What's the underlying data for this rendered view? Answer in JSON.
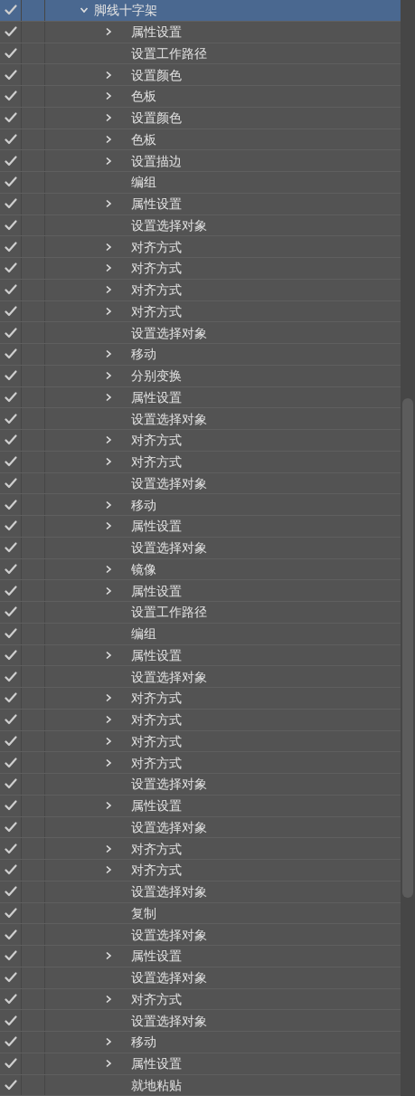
{
  "actions": [
    {
      "name": "脚线十字架",
      "checked": true,
      "selected": true,
      "expanded": true,
      "children": [
        {
          "name": "属性设置",
          "checked": true,
          "expandable": true
        },
        {
          "name": "设置工作路径",
          "checked": true,
          "expandable": false
        },
        {
          "name": "设置颜色",
          "checked": true,
          "expandable": true
        },
        {
          "name": "色板",
          "checked": true,
          "expandable": true
        },
        {
          "name": "设置颜色",
          "checked": true,
          "expandable": true
        },
        {
          "name": "色板",
          "checked": true,
          "expandable": true
        },
        {
          "name": "设置描边",
          "checked": true,
          "expandable": true
        },
        {
          "name": "编组",
          "checked": true,
          "expandable": false
        },
        {
          "name": "属性设置",
          "checked": true,
          "expandable": true
        },
        {
          "name": "设置选择对象",
          "checked": true,
          "expandable": false
        },
        {
          "name": "对齐方式",
          "checked": true,
          "expandable": true
        },
        {
          "name": "对齐方式",
          "checked": true,
          "expandable": true
        },
        {
          "name": "对齐方式",
          "checked": true,
          "expandable": true
        },
        {
          "name": "对齐方式",
          "checked": true,
          "expandable": true
        },
        {
          "name": "设置选择对象",
          "checked": true,
          "expandable": false
        },
        {
          "name": "移动",
          "checked": true,
          "expandable": true
        },
        {
          "name": "分别变换",
          "checked": true,
          "expandable": true
        },
        {
          "name": "属性设置",
          "checked": true,
          "expandable": true
        },
        {
          "name": "设置选择对象",
          "checked": true,
          "expandable": false
        },
        {
          "name": "对齐方式",
          "checked": true,
          "expandable": true
        },
        {
          "name": "对齐方式",
          "checked": true,
          "expandable": true
        },
        {
          "name": "设置选择对象",
          "checked": true,
          "expandable": false
        },
        {
          "name": "移动",
          "checked": true,
          "expandable": true
        },
        {
          "name": "属性设置",
          "checked": true,
          "expandable": true
        },
        {
          "name": "设置选择对象",
          "checked": true,
          "expandable": false
        },
        {
          "name": "镜像",
          "checked": true,
          "expandable": true
        },
        {
          "name": "属性设置",
          "checked": true,
          "expandable": true
        },
        {
          "name": "设置工作路径",
          "checked": true,
          "expandable": false
        },
        {
          "name": "编组",
          "checked": true,
          "expandable": false
        },
        {
          "name": "属性设置",
          "checked": true,
          "expandable": true
        },
        {
          "name": "设置选择对象",
          "checked": true,
          "expandable": false
        },
        {
          "name": "对齐方式",
          "checked": true,
          "expandable": true
        },
        {
          "name": "对齐方式",
          "checked": true,
          "expandable": true
        },
        {
          "name": "对齐方式",
          "checked": true,
          "expandable": true
        },
        {
          "name": "对齐方式",
          "checked": true,
          "expandable": true
        },
        {
          "name": "设置选择对象",
          "checked": true,
          "expandable": false
        },
        {
          "name": "属性设置",
          "checked": true,
          "expandable": true
        },
        {
          "name": "设置选择对象",
          "checked": true,
          "expandable": false
        },
        {
          "name": "对齐方式",
          "checked": true,
          "expandable": true
        },
        {
          "name": "对齐方式",
          "checked": true,
          "expandable": true
        },
        {
          "name": "设置选择对象",
          "checked": true,
          "expandable": false
        },
        {
          "name": "复制",
          "checked": true,
          "expandable": false
        },
        {
          "name": "设置选择对象",
          "checked": true,
          "expandable": false
        },
        {
          "name": "属性设置",
          "checked": true,
          "expandable": true
        },
        {
          "name": "设置选择对象",
          "checked": true,
          "expandable": false
        },
        {
          "name": "对齐方式",
          "checked": true,
          "expandable": true
        },
        {
          "name": "设置选择对象",
          "checked": true,
          "expandable": false
        },
        {
          "name": "移动",
          "checked": true,
          "expandable": true
        },
        {
          "name": "属性设置",
          "checked": true,
          "expandable": true
        },
        {
          "name": "就地粘贴",
          "checked": true,
          "expandable": false
        }
      ]
    }
  ]
}
